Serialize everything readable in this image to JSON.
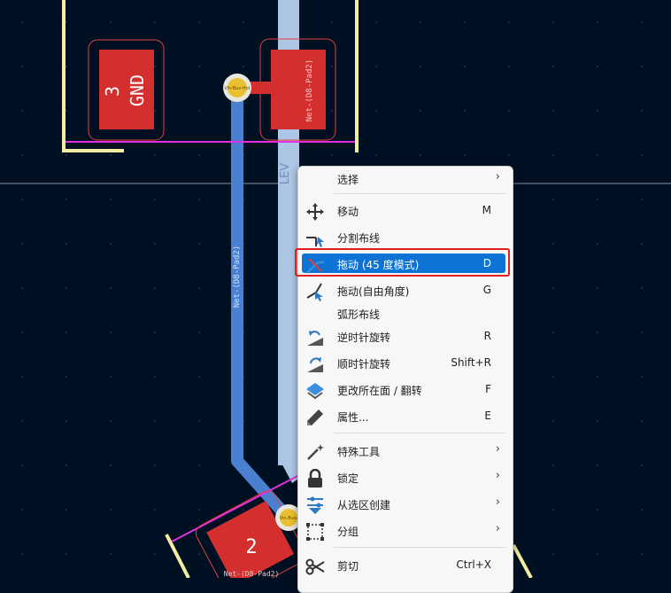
{
  "board": {
    "pad_gnd": {
      "number": "3",
      "net": "GND"
    },
    "pad_right_net": "Net-(D8-Pad2)",
    "track_net": "Net-(D8-Pad2)",
    "via_label": "Vin-Bus-Hot",
    "via2_label": "Vin-Bus-",
    "pad_bottom": {
      "number": "2",
      "net": "Net-(D8-Pad2)"
    },
    "wide_track_label": "LEV",
    "colors": {
      "background": "#001023",
      "pad": "#d32f2f",
      "track": "#4a80d0",
      "silkscreen": "#f2eda0",
      "courtyard": "#e030e0",
      "via": "#e8c030"
    }
  },
  "menu": {
    "select": {
      "label": "选择"
    },
    "move": {
      "label": "移动",
      "shortcut": "M",
      "icon": "move-icon"
    },
    "break": {
      "label": "分割布线",
      "icon": "break-track-icon"
    },
    "drag45": {
      "label": "拖动 (45 度模式)",
      "shortcut": "D",
      "icon": "drag-45-icon"
    },
    "dragfree": {
      "label": "拖动(自由角度)",
      "shortcut": "G",
      "icon": "drag-free-icon"
    },
    "arc": {
      "label": "弧形布线"
    },
    "rotate_ccw": {
      "label": "逆时针旋转",
      "shortcut": "R",
      "icon": "rotate-ccw-icon"
    },
    "rotate_cw": {
      "label": "顺时针旋转",
      "shortcut": "Shift+R",
      "icon": "rotate-cw-icon"
    },
    "flip": {
      "label": "更改所在面 / 翻转",
      "shortcut": "F",
      "icon": "flip-icon"
    },
    "props": {
      "label": "属性...",
      "shortcut": "E",
      "icon": "pencil-icon"
    },
    "special": {
      "label": "特殊工具",
      "icon": "magic-wand-icon"
    },
    "lock": {
      "label": "锁定",
      "icon": "lock-icon"
    },
    "create": {
      "label": "从选区创建",
      "icon": "create-from-selection-icon"
    },
    "group": {
      "label": "分组",
      "icon": "group-icon"
    },
    "cut": {
      "label": "剪切",
      "shortcut": "Ctrl+X",
      "icon": "scissors-icon"
    }
  }
}
